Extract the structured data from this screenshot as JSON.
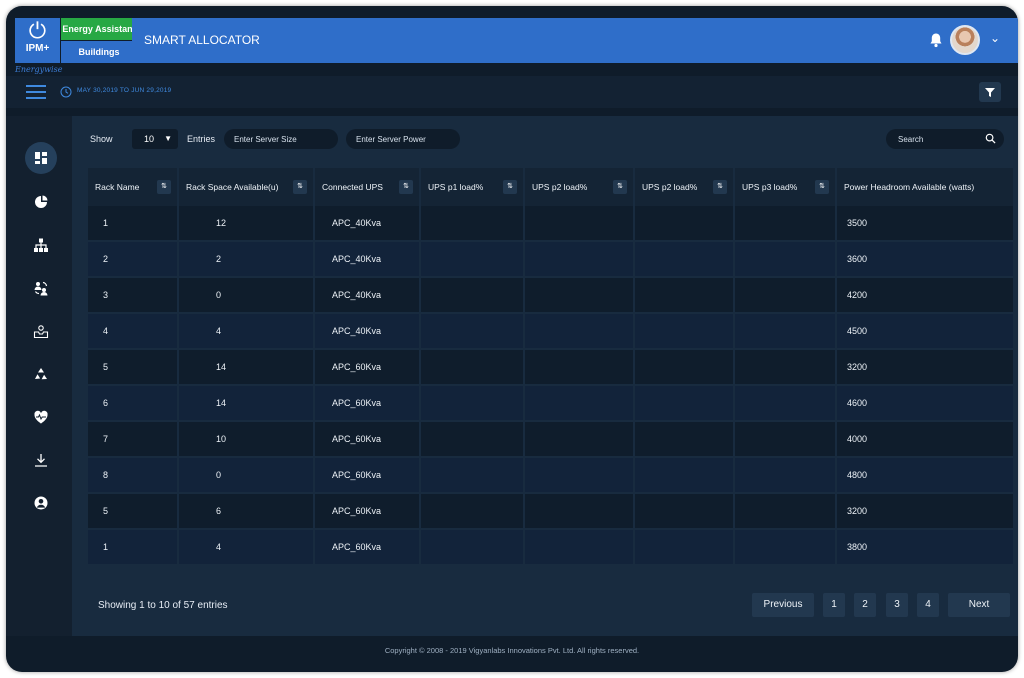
{
  "brand": {
    "logo_text": "IPM+",
    "tag_primary": "Energy Assistant",
    "tag_secondary": "Buildings",
    "signature": "Energywise"
  },
  "header": {
    "title": "SMART ALLOCATOR"
  },
  "subbar": {
    "date_range": "MAY 30,2019 TO JUN 29,2019"
  },
  "controls": {
    "show_label": "Show",
    "entries_value": "10",
    "entries_label": "Entries",
    "server_size_placeholder": "Enter Server Size",
    "server_power_placeholder": "Enter Server Power",
    "search_placeholder": "Search"
  },
  "table": {
    "columns": [
      "Rack Name",
      "Rack Space Available(u)",
      "Connected UPS",
      "UPS p1 load%",
      "UPS p2 load%",
      "UPS p2 load%",
      "UPS p3 load%",
      "Power Headroom Available (watts)"
    ],
    "rows": [
      [
        "1",
        "12",
        "APC_40Kva",
        "",
        "",
        "",
        "",
        "3500"
      ],
      [
        "2",
        "2",
        "APC_40Kva",
        "",
        "",
        "",
        "",
        "3600"
      ],
      [
        "3",
        "0",
        "APC_40Kva",
        "",
        "",
        "",
        "",
        "4200"
      ],
      [
        "4",
        "4",
        "APC_40Kva",
        "",
        "",
        "",
        "",
        "4500"
      ],
      [
        "5",
        "14",
        "APC_60Kva",
        "",
        "",
        "",
        "",
        "3200"
      ],
      [
        "6",
        "14",
        "APC_60Kva",
        "",
        "",
        "",
        "",
        "4600"
      ],
      [
        "7",
        "10",
        "APC_60Kva",
        "",
        "",
        "",
        "",
        "4000"
      ],
      [
        "8",
        "0",
        "APC_60Kva",
        "",
        "",
        "",
        "",
        "4800"
      ],
      [
        "5",
        "6",
        "APC_60Kva",
        "",
        "",
        "",
        "",
        "3200"
      ],
      [
        "1",
        "4",
        "APC_60Kva",
        "",
        "",
        "",
        "",
        "3800"
      ]
    ]
  },
  "pagination": {
    "info": "Showing 1 to 10 of 57 entries",
    "previous": "Previous",
    "pages": [
      "1",
      "2",
      "3",
      "4"
    ],
    "next": "Next"
  },
  "footer": {
    "copyright": "Copyright © 2008 - 2019 Vigyanlabs Innovations Pvt. Ltd. All rights reserved."
  },
  "nav_icons": [
    "dashboard-icon",
    "pie-chart-icon",
    "hierarchy-icon",
    "people-sync-icon",
    "inbox-user-icon",
    "recycle-icon",
    "heart-pulse-icon",
    "download-icon",
    "user-circle-icon"
  ],
  "colors": {
    "primary": "#2f6ec9",
    "accent_green": "#27a844",
    "background": "#0f1c2a",
    "panel": "#182b3f"
  }
}
